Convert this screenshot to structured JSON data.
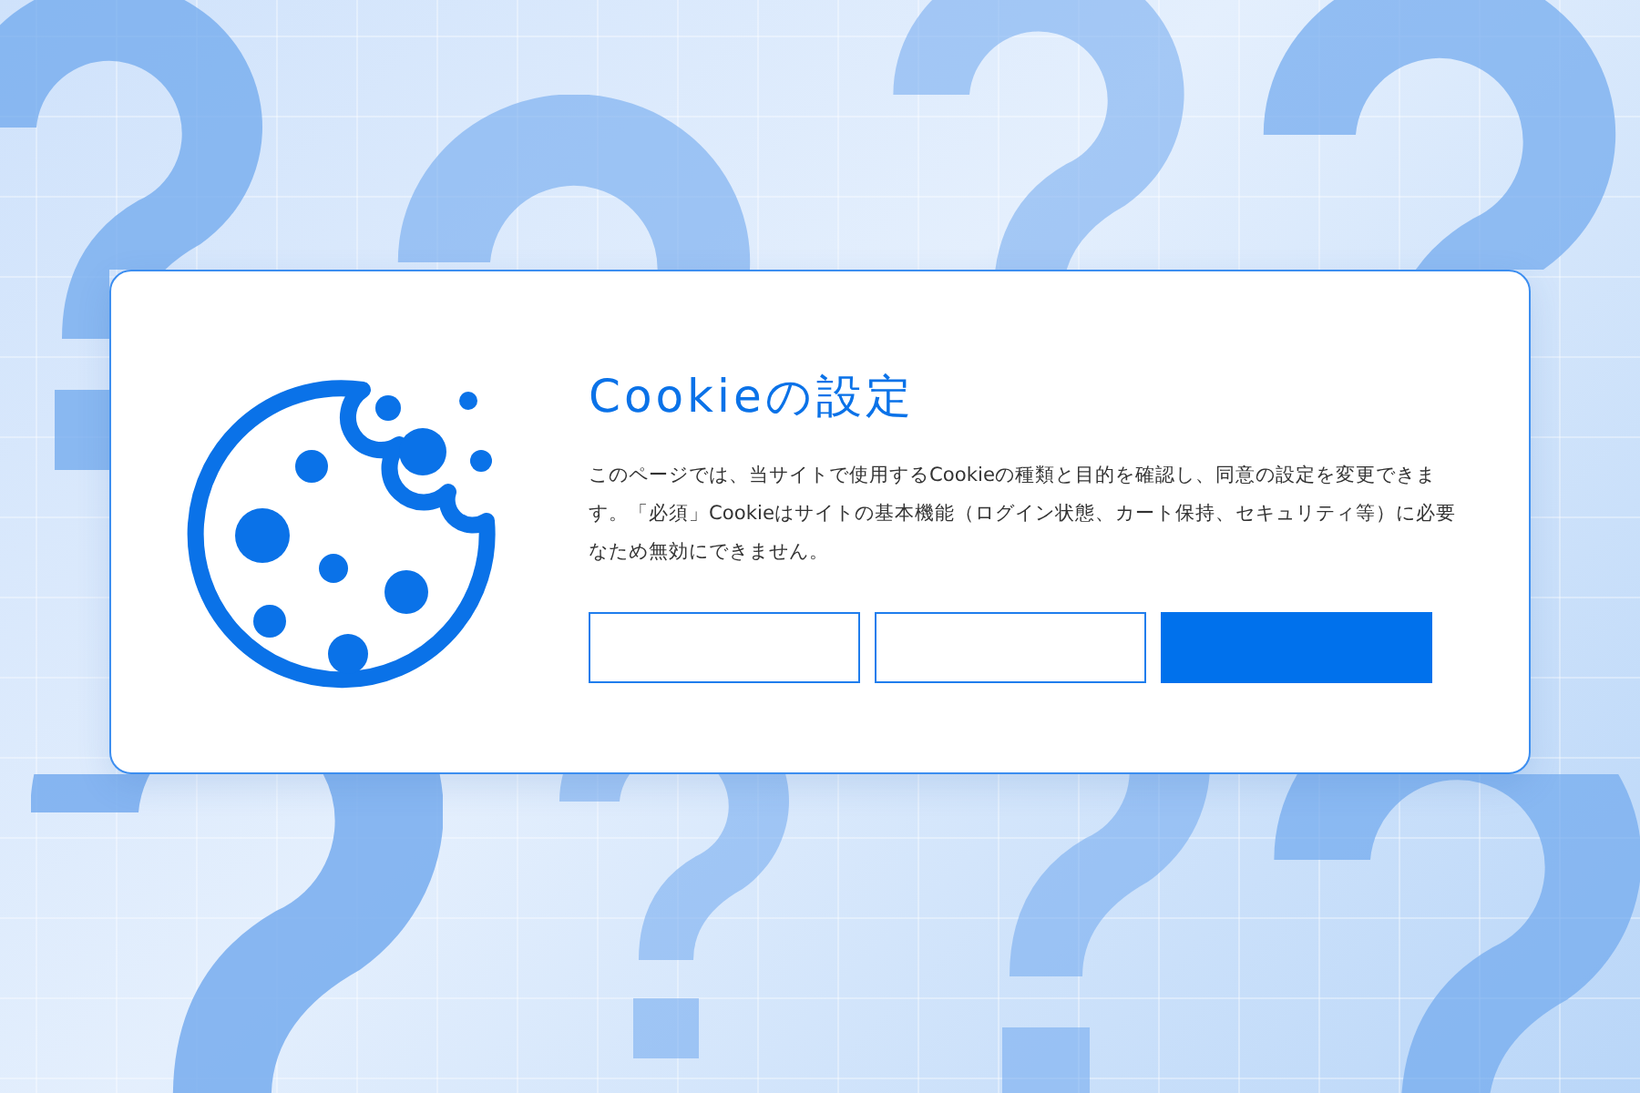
{
  "dialog": {
    "title": "Cookieの設定",
    "description": "このページでは、当サイトで使用するCookieの種類と目的を確認し、同意の設定を変更できます。「必須」Cookieはサイトの基本機能（ログイン状態、カート保持、セキュリティ等）に必要なため無効にできません。",
    "buttons": [
      {
        "kind": "outline"
      },
      {
        "kind": "outline"
      },
      {
        "kind": "filled"
      }
    ]
  }
}
